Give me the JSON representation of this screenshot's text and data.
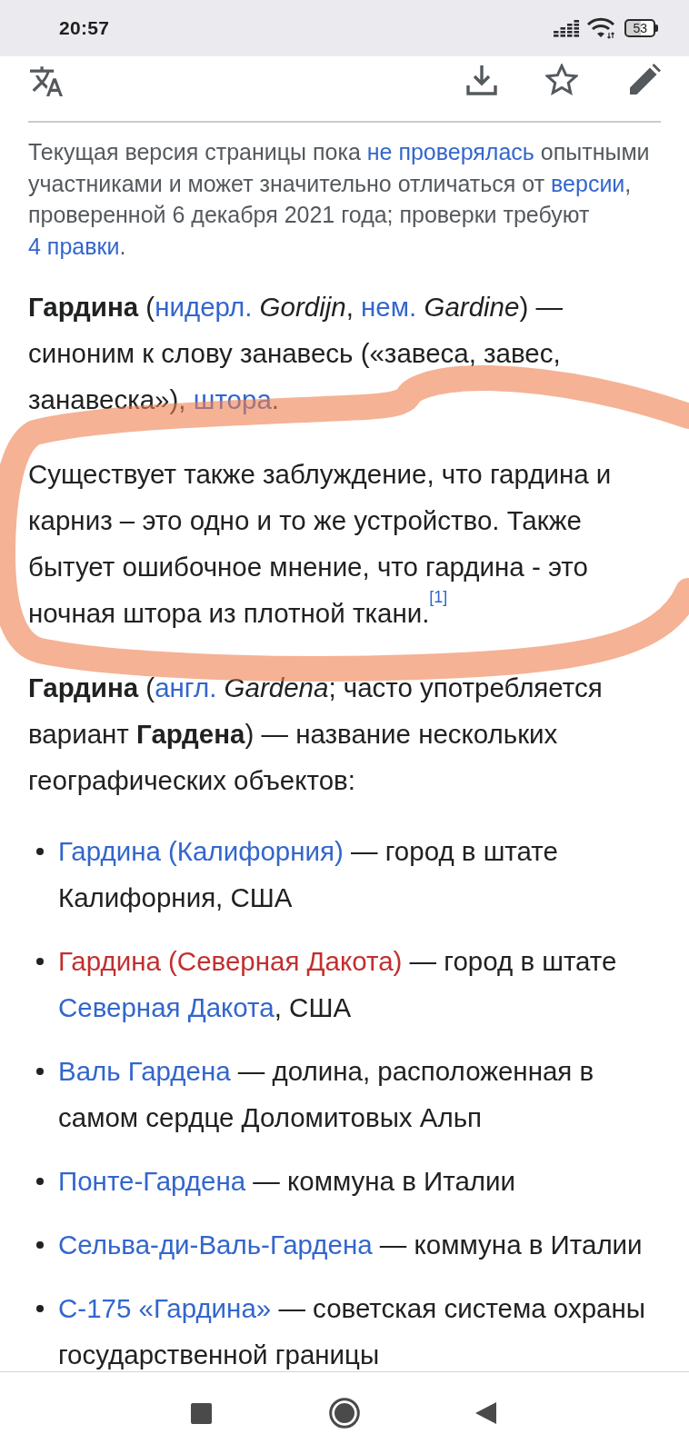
{
  "status_bar": {
    "time": "20:57",
    "battery": "53"
  },
  "notice": {
    "parts": [
      {
        "kind": "text",
        "text": "Текущая версия страницы пока "
      },
      {
        "kind": "link",
        "text": "не проверялась"
      },
      {
        "kind": "text",
        "text": " опытными участниками и может значительно отличаться от "
      },
      {
        "kind": "link",
        "text": "версии"
      },
      {
        "kind": "text",
        "text": ", проверенной 6 декабря 2021 года; проверки требуют "
      },
      {
        "kind": "link",
        "text": "4 правки"
      },
      {
        "kind": "text",
        "text": "."
      }
    ]
  },
  "paragraphs": [
    {
      "parts": [
        {
          "kind": "text",
          "text": "**Гардина** ("
        },
        {
          "kind": "link",
          "text": "нидерл."
        },
        {
          "kind": "text",
          "text": " *Gordijn*, "
        },
        {
          "kind": "link",
          "text": "нем."
        },
        {
          "kind": "text",
          "text": " *Gardine*) — синоним к слову занавесь («завеса, завес, занавеска»), "
        },
        {
          "kind": "link",
          "text": "штора"
        },
        {
          "kind": "text",
          "text": "."
        }
      ]
    },
    {
      "parts": [
        {
          "kind": "text",
          "text": "Существует также заблуждение, что гардина и карниз – это одно и то же устройство. Также бытует ошибочное мнение, что гардина - это ночная штора из плотной ткани."
        },
        {
          "kind": "ref",
          "text": "[1]"
        }
      ]
    },
    {
      "parts": [
        {
          "kind": "text",
          "text": "**Гардина** ("
        },
        {
          "kind": "link",
          "text": "англ."
        },
        {
          "kind": "text",
          "text": " *Gardena*; часто употребляется вариант **Гардена**) — название нескольких географических объектов:"
        }
      ]
    }
  ],
  "list": [
    {
      "parts": [
        {
          "kind": "link",
          "text": "Гардина (Калифорния)"
        },
        {
          "kind": "text",
          "text": " — город в штате Калифорния, США"
        }
      ]
    },
    {
      "parts": [
        {
          "kind": "redlink",
          "text": "Гардина (Северная Дакота)"
        },
        {
          "kind": "text",
          "text": " — город в штате "
        },
        {
          "kind": "link",
          "text": "Северная Дакота"
        },
        {
          "kind": "text",
          "text": ", США"
        }
      ]
    },
    {
      "parts": [
        {
          "kind": "link",
          "text": "Валь Гардена"
        },
        {
          "kind": "text",
          "text": " — долина, расположенная в самом сердце Доломитовых Альп"
        }
      ]
    },
    {
      "parts": [
        {
          "kind": "link",
          "text": "Понте-Гардена"
        },
        {
          "kind": "text",
          "text": " — коммуна в Италии"
        }
      ]
    },
    {
      "parts": [
        {
          "kind": "link",
          "text": "Сельва-ди-Валь-Гардена"
        },
        {
          "kind": "text",
          "text": " — коммуна в Италии"
        }
      ]
    },
    {
      "parts": [
        {
          "kind": "link",
          "text": "С-175 «Гардина»"
        },
        {
          "kind": "text",
          "text": " — советская система охраны государственной границы"
        }
      ]
    }
  ]
}
